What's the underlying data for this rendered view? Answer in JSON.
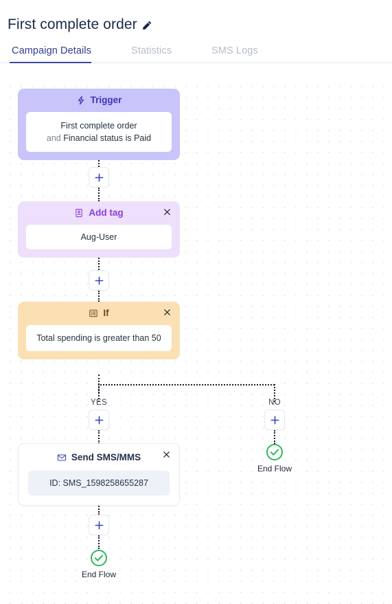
{
  "header": {
    "title": "First complete order",
    "edit_icon": "pencil-icon",
    "tabs": [
      {
        "label": "Campaign Details",
        "active": true
      },
      {
        "label": "Statistics",
        "active": false
      },
      {
        "label": "SMS Logs",
        "active": false
      }
    ]
  },
  "flow": {
    "nodes": [
      {
        "id": "trigger",
        "icon": "lightning-bolt-icon",
        "title": "Trigger",
        "body_line1": "First complete order",
        "body_and": "and",
        "body_line2": "Financial status is Paid",
        "closable": false,
        "bg": "#c9c4f9",
        "title_color": "#3c36b8"
      },
      {
        "id": "add-tag",
        "icon": "contact-card-icon",
        "title": "Add tag",
        "body": "Aug-User",
        "closable": true,
        "close_label": "close-icon",
        "bg": "#eedffc",
        "title_color": "#8a3fd6"
      },
      {
        "id": "if",
        "icon": "list-icon",
        "title": "If",
        "body": "Total spending is greater than 50",
        "closable": true,
        "close_label": "close-icon",
        "bg": "#fbe0b4",
        "title_color": "#6d4a14"
      },
      {
        "id": "send-sms",
        "icon": "envelope-icon",
        "title": "Send SMS/MMS",
        "body": "ID: SMS_1598258655287",
        "closable": true,
        "close_label": "close-icon",
        "bg": "#ffffff",
        "title_color": "#23314b"
      }
    ],
    "branch_labels": {
      "yes": "YES",
      "no": "NO"
    },
    "add_button_label": "+",
    "end_nodes": [
      {
        "id": "end-flow-no",
        "label": "End Flow",
        "icon": "check-circle-icon",
        "color": "#2fb85d"
      },
      {
        "id": "end-flow-yes",
        "label": "End Flow",
        "icon": "check-circle-icon",
        "color": "#2fb85d"
      }
    ]
  },
  "colors": {
    "accent": "#3b4aa0",
    "plus": "#3b3fc4",
    "success": "#2fb85d",
    "connector": "#1c1c2b",
    "tab_inactive": "#b6bcc9"
  }
}
